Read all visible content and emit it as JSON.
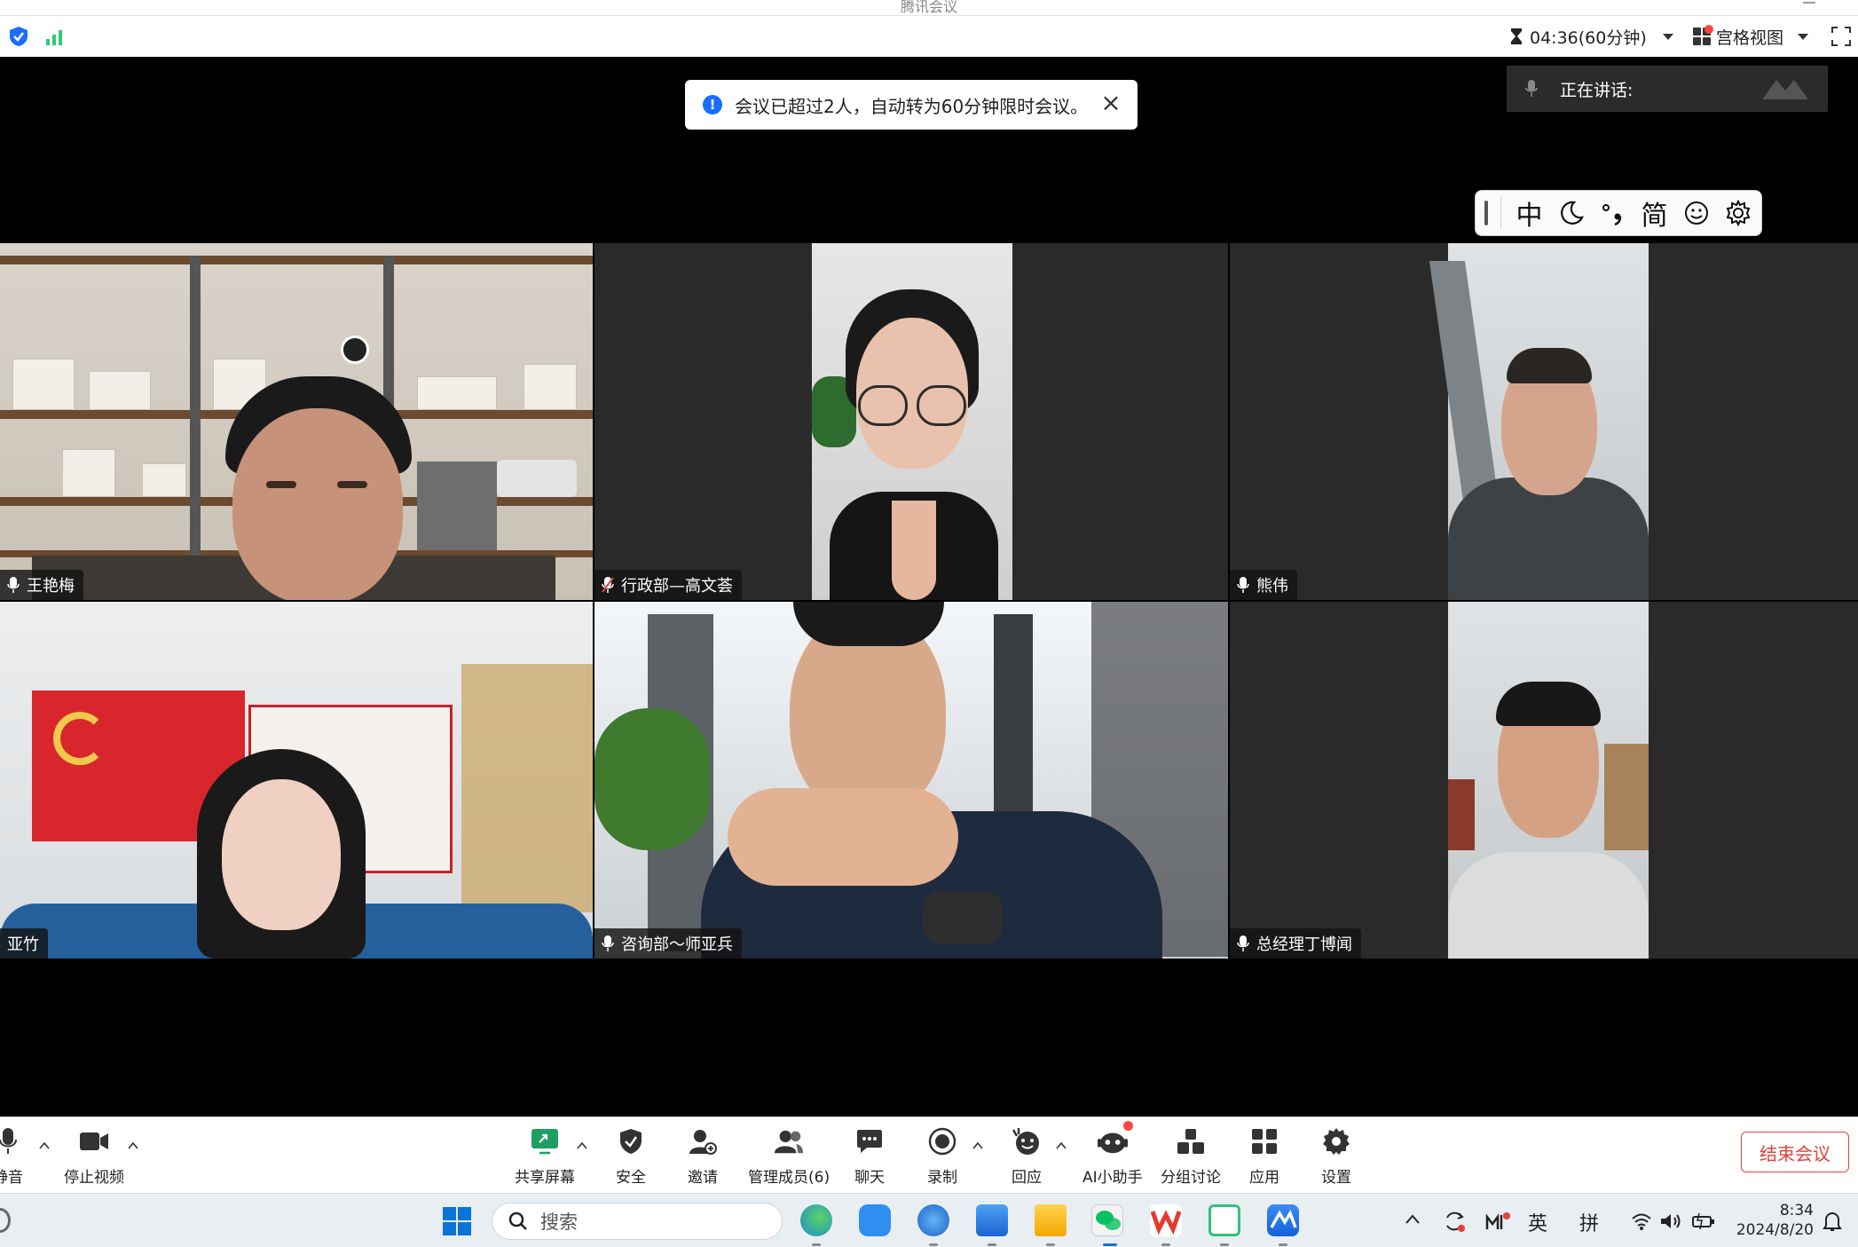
{
  "window": {
    "title": "腾讯会议"
  },
  "topbar": {
    "timer": "04:36(60分钟)",
    "view_label": "宫格视图"
  },
  "notification": {
    "text": "会议已超过2人，自动转为60分钟限时会议。"
  },
  "speaking": {
    "label": "正在讲话:"
  },
  "ime": {
    "items": [
      "中",
      "简"
    ]
  },
  "participants": [
    {
      "name": "王艳梅"
    },
    {
      "name": "行政部—高文荟"
    },
    {
      "name": "熊伟"
    },
    {
      "name": "亚竹"
    },
    {
      "name": "咨询部～师亚兵"
    },
    {
      "name": "总经理丁博闻"
    }
  ],
  "toolbar": {
    "mute": "静音",
    "stop_video": "停止视频",
    "share": "共享屏幕",
    "security": "安全",
    "invite": "邀请",
    "members": "管理成员(6)",
    "chat": "聊天",
    "record": "录制",
    "react": "回应",
    "ai": "AI小助手",
    "breakout": "分组讨论",
    "apps": "应用",
    "settings": "设置",
    "end": "结束会议"
  },
  "taskbar": {
    "search_placeholder": "搜索",
    "lang1": "英",
    "lang2": "拼",
    "time": "8:34",
    "date": "2024/8/20"
  },
  "colors": {
    "accent": "#1a6dff",
    "end": "#e4413a",
    "tile_bg": "#2a2a2a"
  }
}
